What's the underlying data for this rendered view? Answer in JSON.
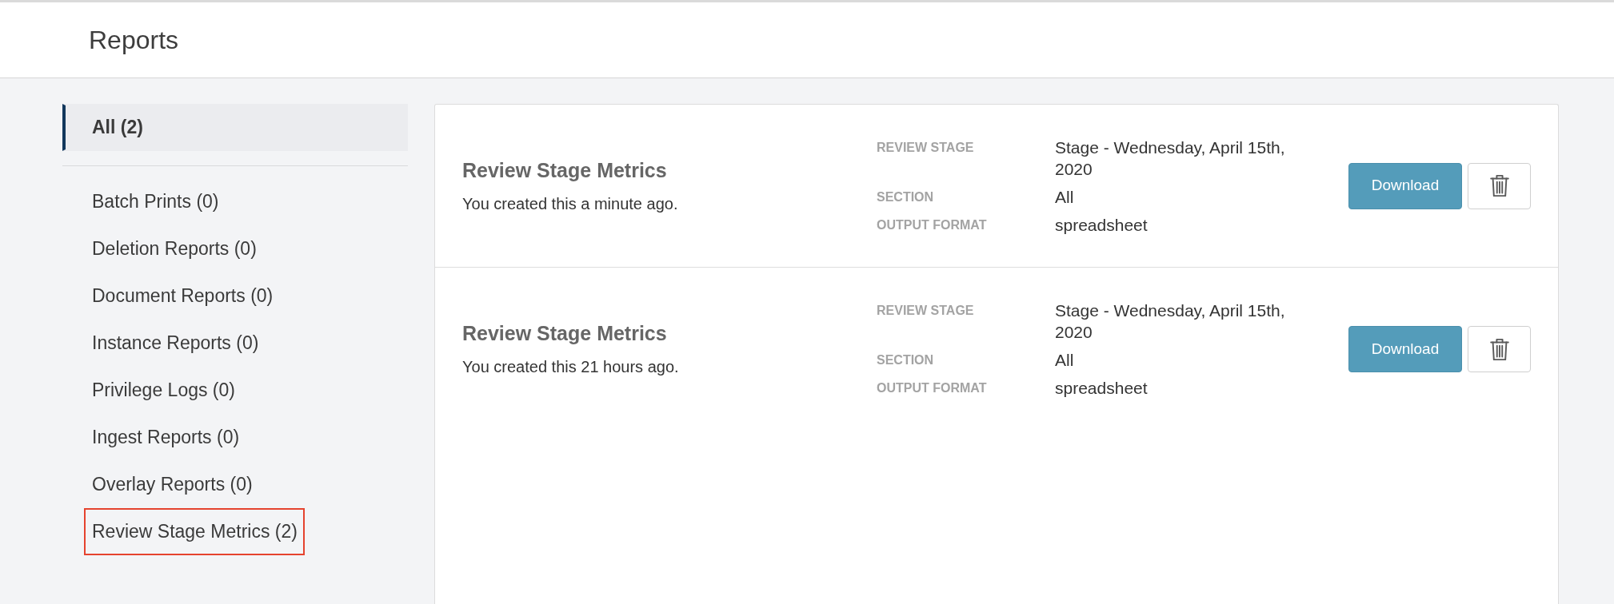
{
  "header": {
    "title": "Reports"
  },
  "sidebar": {
    "groups": [
      {
        "items": [
          {
            "label": "All (2)",
            "selected": true,
            "highlighted": false
          }
        ]
      },
      {
        "items": [
          {
            "label": "Batch Prints (0)",
            "selected": false,
            "highlighted": false
          },
          {
            "label": "Deletion Reports (0)",
            "selected": false,
            "highlighted": false
          },
          {
            "label": "Document Reports (0)",
            "selected": false,
            "highlighted": false
          },
          {
            "label": "Instance Reports (0)",
            "selected": false,
            "highlighted": false
          },
          {
            "label": "Privilege Logs (0)",
            "selected": false,
            "highlighted": false
          },
          {
            "label": "Ingest Reports (0)",
            "selected": false,
            "highlighted": false
          },
          {
            "label": "Overlay Reports (0)",
            "selected": false,
            "highlighted": false
          },
          {
            "label": "Review Stage Metrics (2)",
            "selected": false,
            "highlighted": true
          }
        ]
      }
    ]
  },
  "reports": [
    {
      "title": "Review Stage Metrics",
      "subtitle": "You created this a minute ago.",
      "details": [
        {
          "label": "REVIEW STAGE",
          "value": "Stage - Wednesday, April 15th, 2020"
        },
        {
          "label": "SECTION",
          "value": "All"
        },
        {
          "label": "OUTPUT FORMAT",
          "value": "spreadsheet"
        }
      ],
      "download_button": "Download"
    },
    {
      "title": "Review Stage Metrics",
      "subtitle": "You created this 21 hours ago.",
      "details": [
        {
          "label": "REVIEW STAGE",
          "value": "Stage - Wednesday, April 15th, 2020"
        },
        {
          "label": "SECTION",
          "value": "All"
        },
        {
          "label": "OUTPUT FORMAT",
          "value": "spreadsheet"
        }
      ],
      "download_button": "Download"
    }
  ]
}
